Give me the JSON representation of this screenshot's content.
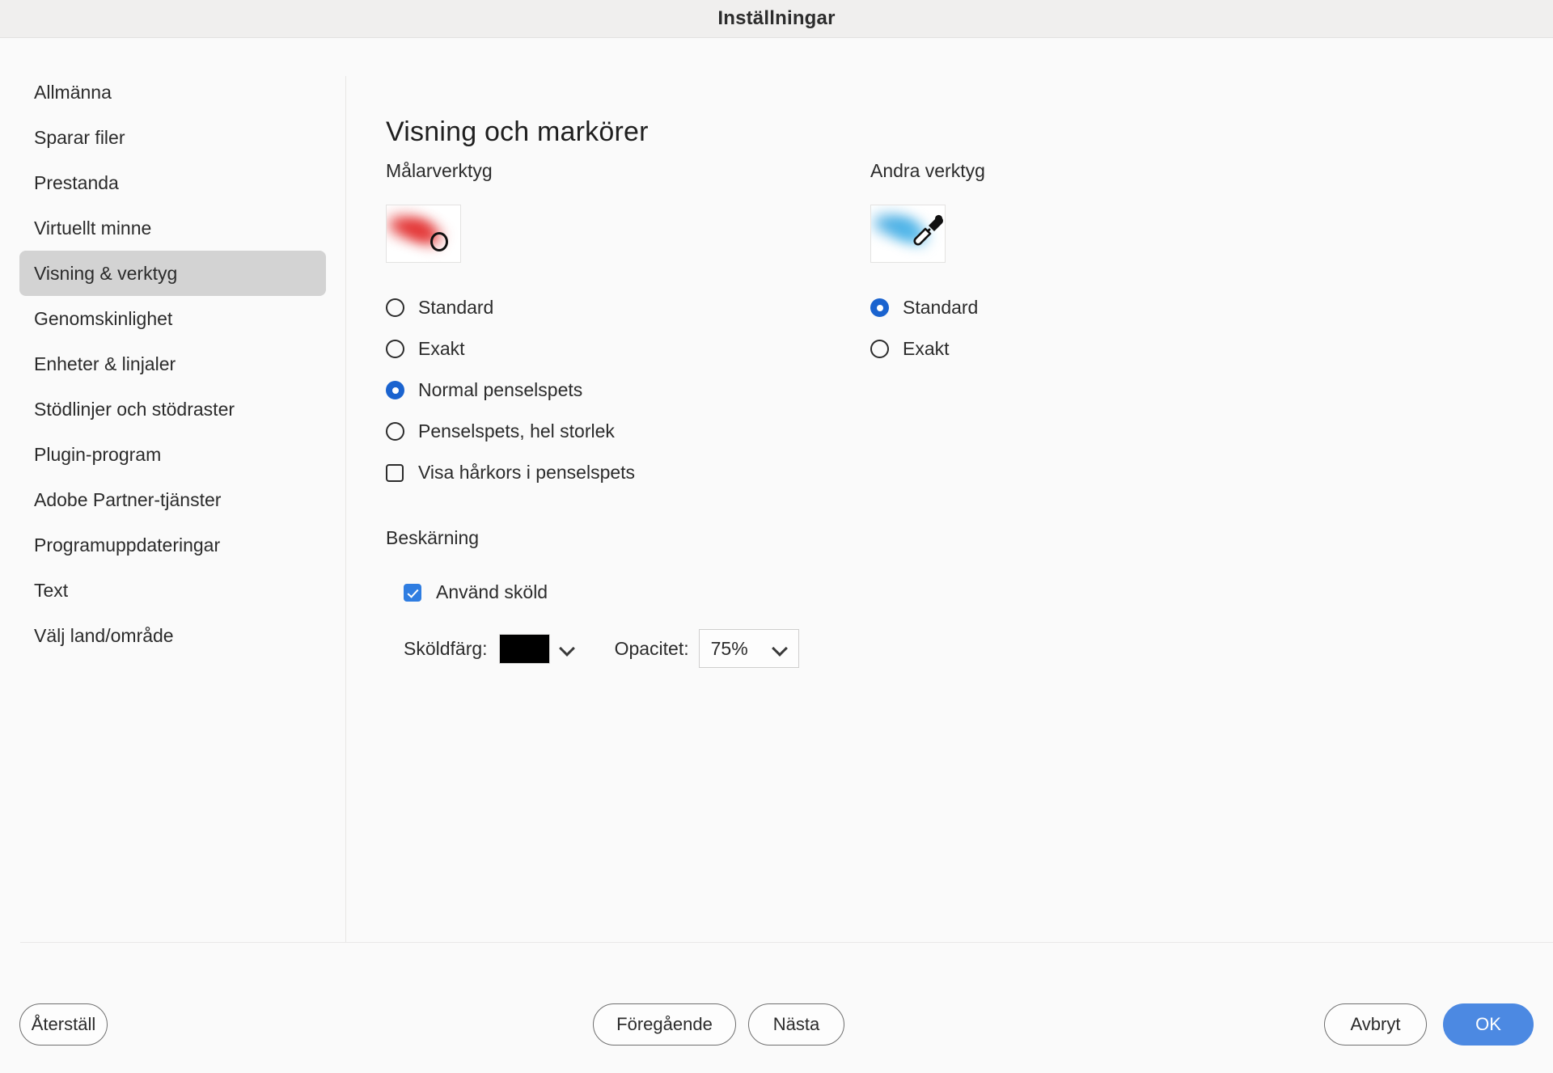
{
  "window": {
    "title": "Inställningar"
  },
  "sidebar": {
    "items": [
      {
        "label": "Allmänna",
        "selected": false
      },
      {
        "label": "Sparar filer",
        "selected": false
      },
      {
        "label": "Prestanda",
        "selected": false
      },
      {
        "label": "Virtuellt minne",
        "selected": false
      },
      {
        "label": "Visning & verktyg",
        "selected": true
      },
      {
        "label": "Genomskinlighet",
        "selected": false
      },
      {
        "label": "Enheter & linjaler",
        "selected": false
      },
      {
        "label": "Stödlinjer och stödraster",
        "selected": false
      },
      {
        "label": "Plugin-program",
        "selected": false
      },
      {
        "label": "Adobe Partner-tjänster",
        "selected": false
      },
      {
        "label": "Programuppdateringar",
        "selected": false
      },
      {
        "label": "Text",
        "selected": false
      },
      {
        "label": "Välj land/område",
        "selected": false
      }
    ]
  },
  "main": {
    "page_title": "Visning och markörer",
    "painting": {
      "group_title": "Målarverktyg",
      "preview_icon": "red-brush-stroke-with-circle-cursor",
      "options": [
        {
          "label": "Standard",
          "checked": false
        },
        {
          "label": "Exakt",
          "checked": false
        },
        {
          "label": "Normal penselspets",
          "checked": true
        },
        {
          "label": "Penselspets, hel storlek",
          "checked": false
        }
      ],
      "checkbox": {
        "label": "Visa hårkors i penselspets",
        "checked": false
      }
    },
    "other_tools": {
      "group_title": "Andra verktyg",
      "preview_icon": "blue-stroke-with-eyedropper-cursor",
      "options": [
        {
          "label": "Standard",
          "checked": true
        },
        {
          "label": "Exakt",
          "checked": false
        }
      ]
    },
    "crop": {
      "group_title": "Beskärning",
      "use_shield": {
        "label": "Använd sköld",
        "checked": true
      },
      "shield_color_label": "Sköldfärg:",
      "shield_color_value": "#000000",
      "opacity_label": "Opacitet:",
      "opacity_value": "75%"
    }
  },
  "footer": {
    "reset_label": "Återställ",
    "previous_label": "Föregående",
    "next_label": "Nästa",
    "cancel_label": "Avbryt",
    "ok_label": "OK"
  },
  "colors": {
    "accent_blue": "#4c89e2",
    "radio_blue": "#1a63cf",
    "checkbox_blue": "#2f7de1",
    "selected_item_bg": "#d3d3d3"
  }
}
